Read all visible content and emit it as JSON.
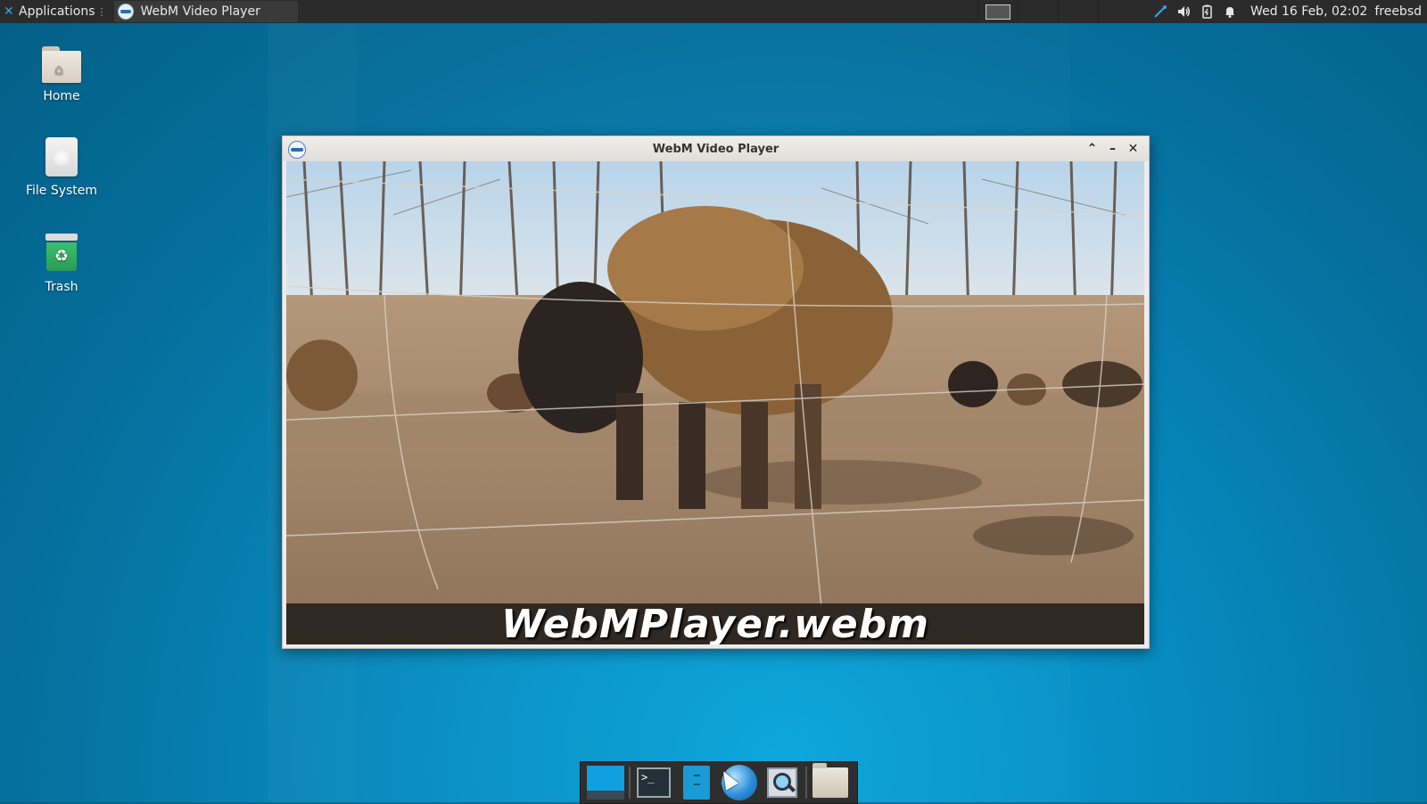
{
  "top_panel": {
    "applications_label": "Applications",
    "applications_separator": "⋮",
    "task_title": "WebM Video Player",
    "clock": "Wed 16 Feb, 02:02",
    "user": "freebsd",
    "tray_icons": [
      "network-icon",
      "volume-icon",
      "battery-icon",
      "notification-bell-icon"
    ]
  },
  "desktop": {
    "icons": [
      {
        "label": "Home",
        "icon": "home-folder-icon"
      },
      {
        "label": "File System",
        "icon": "drive-icon"
      },
      {
        "label": "Trash",
        "icon": "trash-icon"
      }
    ]
  },
  "window": {
    "title": "WebM Video Player",
    "caption": "WebMPlayer.webm",
    "buttons": [
      "maximize-icon",
      "minimize-icon",
      "close-icon"
    ]
  },
  "dock": {
    "items": [
      "show-desktop-icon",
      "terminal-icon",
      "file-manager-icon",
      "web-browser-icon",
      "app-finder-icon",
      "folder-icon"
    ],
    "terminal_prompt": ">_"
  },
  "colors": {
    "panel_bg": "#2b2b2b",
    "desktop_accent": "#078bc0",
    "window_titlebar": "#e6e4df"
  }
}
